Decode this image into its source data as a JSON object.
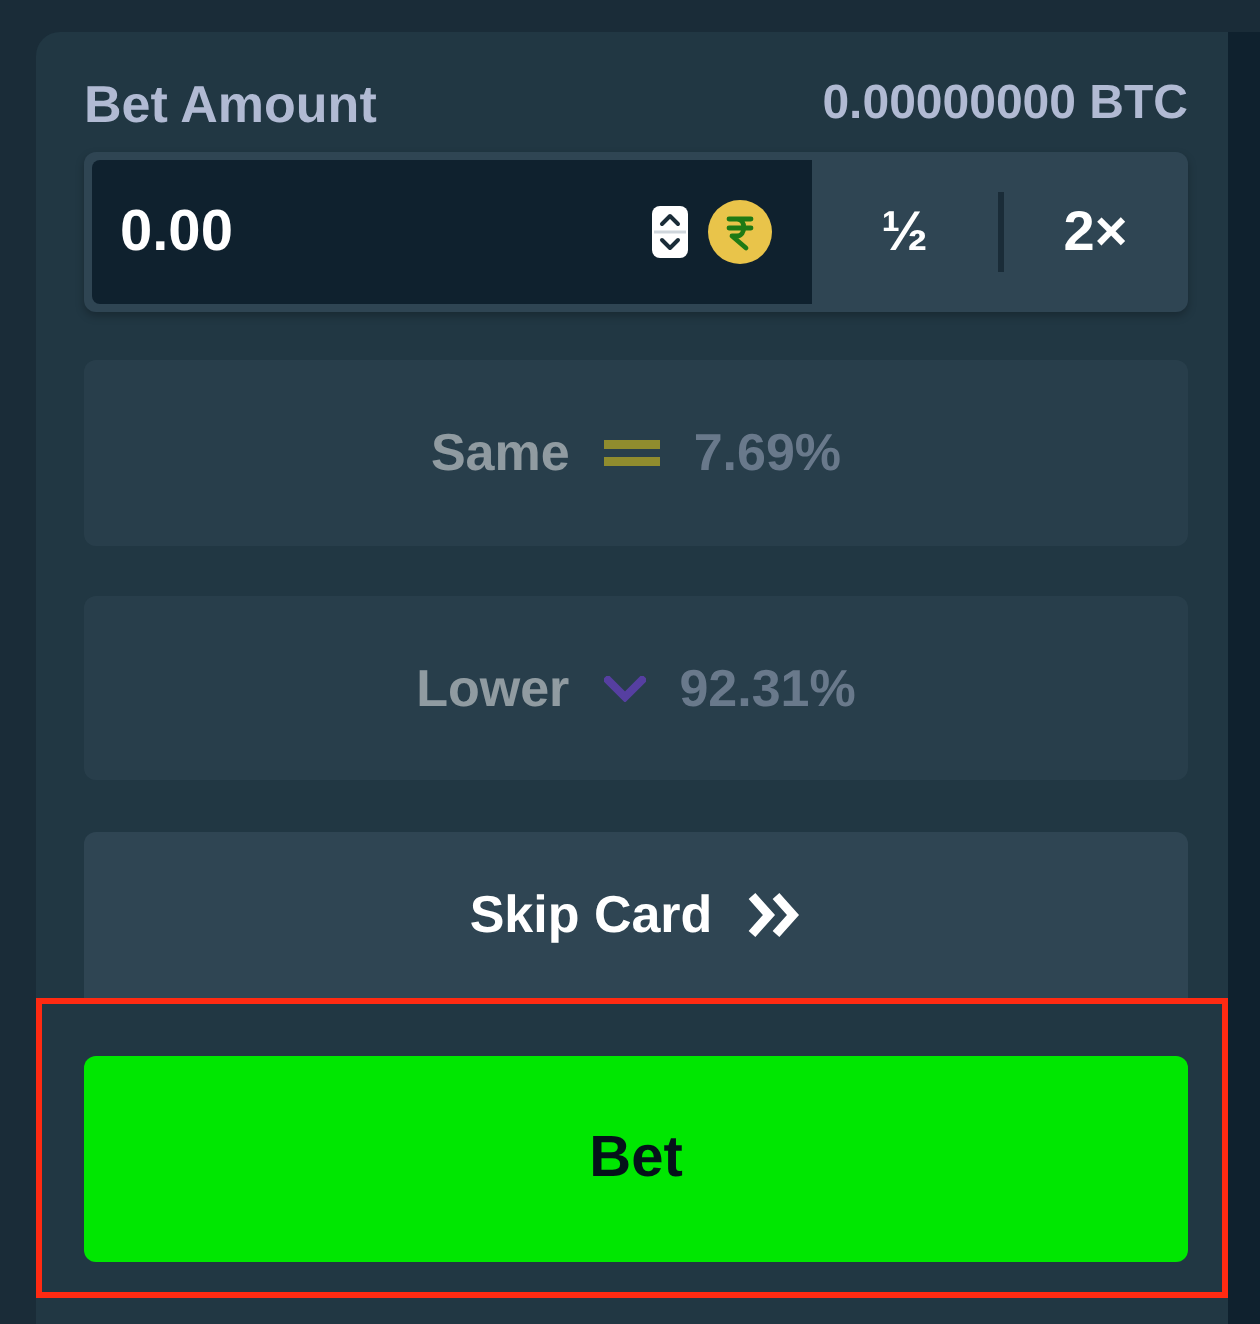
{
  "bet_amount": {
    "label": "Bet Amount",
    "converted": "0.00000000 BTC",
    "value": "0.00",
    "half_label": "½",
    "double_label": "2×"
  },
  "choices": [
    {
      "kind": "same",
      "label": "Same",
      "odds": "7.69%",
      "disabled": true
    },
    {
      "kind": "lower",
      "label": "Lower",
      "odds": "92.31%",
      "disabled": true
    }
  ],
  "skip_button": {
    "label": "Skip Card"
  },
  "bet_button": {
    "label": "Bet",
    "highlighted": true
  }
}
